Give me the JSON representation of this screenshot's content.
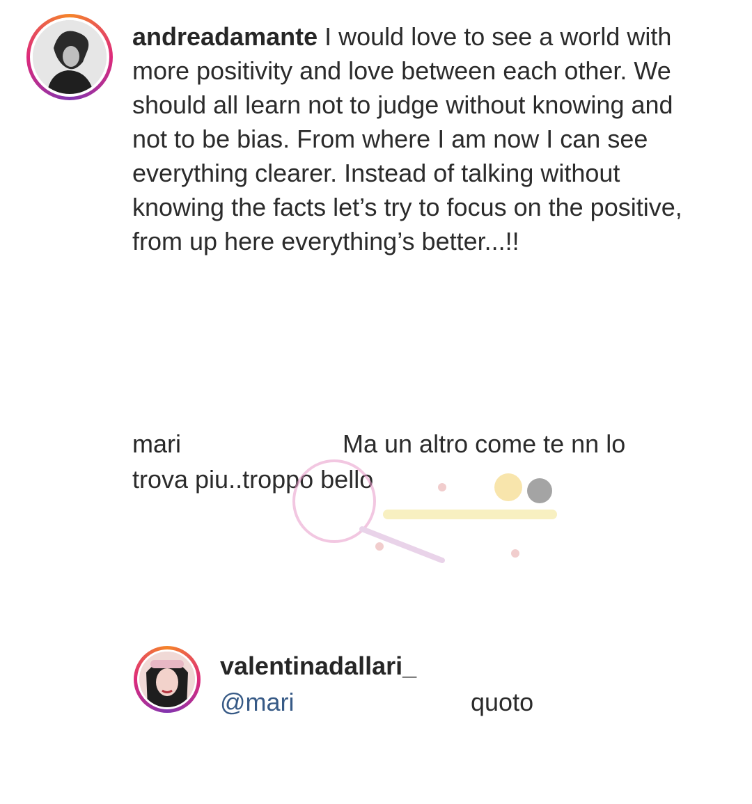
{
  "post_comment": {
    "username": "andreadamante",
    "text": "I would love to see a world with more positivity and love between each other. We should all learn not to judge without knowing and not to be bias. From where I am now I can see everything clearer. Instead of talking without knowing the facts let’s try to focus on the positive, from up here everything’s better...!!"
  },
  "reply_comment": {
    "username": "mari",
    "text": "Ma un altro come te nn lo trova piu..troppo bello"
  },
  "nested_reply": {
    "username": "valentinadallari_",
    "mention": "@mari",
    "text": "quoto"
  },
  "colors": {
    "ring": "#dd2a7b",
    "mention": "#375a86",
    "watermark": "#e89ac9"
  }
}
